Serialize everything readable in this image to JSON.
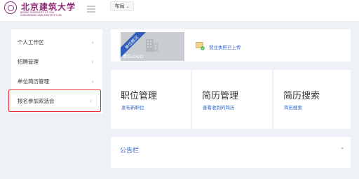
{
  "header": {
    "university_name": "北京建筑大学",
    "university_name_en_1": "BEIJING UNIVERSITY OF CIVIL",
    "university_name_en_2": "ENGINEERING AND ARCHITECTURE",
    "layout_label": "布局"
  },
  "sidebar": {
    "items": [
      {
        "label": "个人工作区"
      },
      {
        "label": "招聘管理"
      },
      {
        "label": "单位简历管理"
      },
      {
        "label": "报名参加双选会",
        "selected": true
      }
    ]
  },
  "upload": {
    "ribbon_label": "单位概况",
    "logo_label": "单位LOGO",
    "license_status": "营业执照已上传"
  },
  "cards": [
    {
      "title": "职位管理",
      "link": "发布新职位"
    },
    {
      "title": "简历管理",
      "link": "查看收到的简历"
    },
    {
      "title": "简历搜索",
      "link": "简历搜索"
    }
  ],
  "bulletin": {
    "title": "公告栏"
  },
  "colors": {
    "accent": "#2e63c8",
    "selected_border": "#e03030",
    "brand": "#8a2a72"
  }
}
